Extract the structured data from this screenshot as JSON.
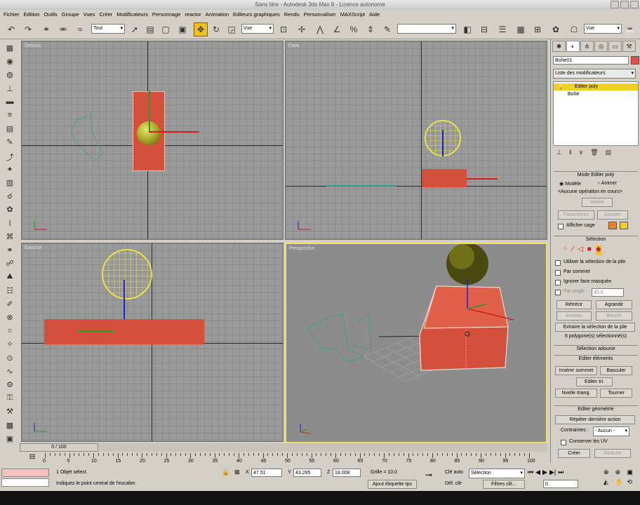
{
  "window": {
    "title": "Sans titre - Autodesk 3ds Max 8 - Licence autonome"
  },
  "menu": [
    "Fichier",
    "Edition",
    "Outils",
    "Groupe",
    "Vues",
    "Créer",
    "Modificateurs",
    "Personnage",
    "reactor",
    "Animation",
    "Editeurs graphiques",
    "Rendu",
    "Personnaliser",
    "MAXScript",
    "Aide"
  ],
  "toolbar": {
    "selection_filter": "Tout",
    "ref_coord": "Vue",
    "named_sel": "",
    "render_view": "Vue"
  },
  "viewports": [
    {
      "label": "Dessus"
    },
    {
      "label": "Face"
    },
    {
      "label": "Gauche"
    },
    {
      "label": "Perspective"
    }
  ],
  "panel": {
    "object_name": "Boîte01",
    "modifier_list": "Liste des modificateurs",
    "stack": [
      "Editer poly",
      "Boîte"
    ],
    "mode_rollout": "Mode Editer poly",
    "radio_model": "Modèle",
    "radio_animate": "Animer",
    "no_op": "<Aucune opération en cours>",
    "validate": "Valider",
    "params": "Paramètres",
    "cancel": "Annuler",
    "show_cage": "Afficher cage",
    "selection_rollout": "Sélection",
    "use_stack_sel": "Utiliser la sélection de la pile",
    "by_vertex": "Par sommet",
    "ignore_backfacing": "Ignorer face masquée",
    "by_angle": "Par angle :",
    "angle_value": "45.0",
    "shrink": "Rétrécir",
    "grow": "Agrandir",
    "ring": "Anneau",
    "loop": "Boucle",
    "get_stack_sel": "Extraire la sélection de la pile",
    "sel_count": "6 polygone(s) sélectionné(s)",
    "soft_sel": "Sélection adoucie",
    "edit_elements": "Editer éléments",
    "insert_vertex": "Insérer sommet",
    "flip": "Basculer",
    "edit_tri": "Editer tri.",
    "retriangulate": "Nvelle triang.",
    "turn": "Tourner",
    "edit_geometry": "Editer géométrie",
    "repeat_last": "Répéter dernière action",
    "constraints_label": "Contraintes :",
    "constraints_value": "- Aucun -",
    "preserve_uv": "Conserver les UV",
    "create": "Créer",
    "collapse": "Réduire"
  },
  "timeline": {
    "frame": "0 / 100",
    "ticks": [
      "0",
      "5",
      "10",
      "15",
      "20",
      "25",
      "30",
      "35",
      "40",
      "45",
      "50",
      "55",
      "60",
      "65",
      "70",
      "75",
      "80",
      "85",
      "90",
      "95",
      "100"
    ]
  },
  "status": {
    "objects": "1 Objet sélect.",
    "prompt": "Indiquez le point central de l'escalier.",
    "x_label": "X",
    "x": "47.51",
    "y_label": "Y",
    "y": "43.295",
    "z_label": "Z",
    "z": "18.008",
    "grid": "Grille = 10.0",
    "add_tag": "Ajout étiquette tps",
    "auto_key": "Clé auto",
    "set_key": "Déf. clé",
    "key_filter_value": "Sélection",
    "key_filters": "Filtres clé...",
    "frame_field": "0"
  },
  "colors": {
    "accent": "#f0c020",
    "object_red": "#d4503c",
    "viewport_bg": "#9a9a9a",
    "active_border": "#f0e060"
  }
}
